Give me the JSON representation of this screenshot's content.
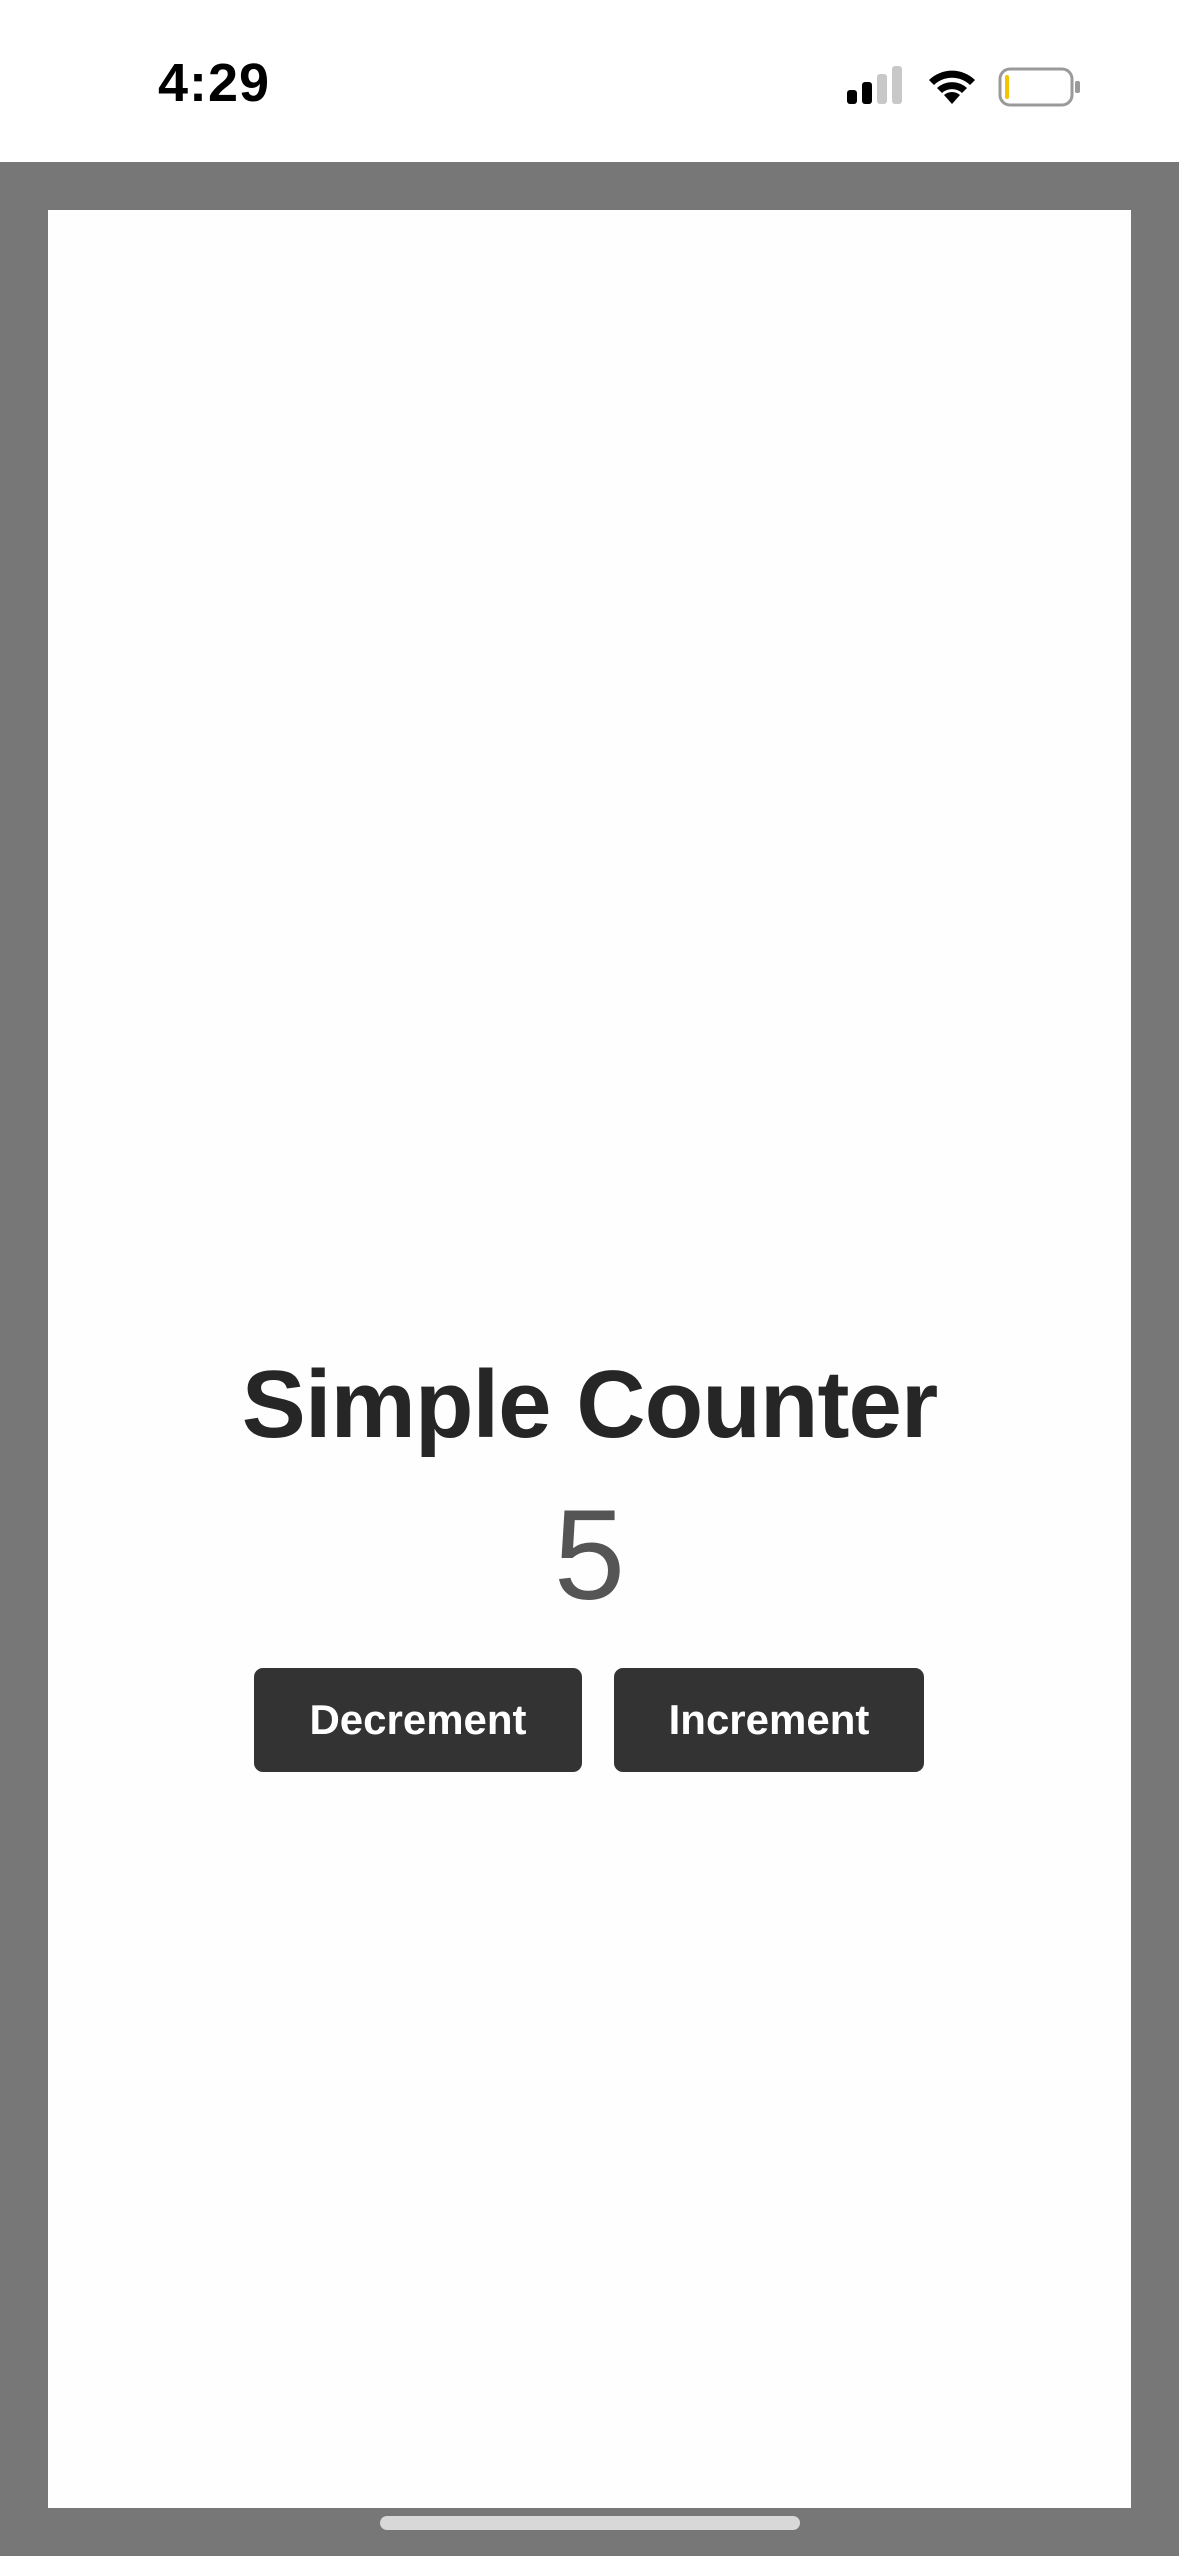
{
  "status_bar": {
    "time": "4:29",
    "signal_icon": "cellular-signal-icon",
    "wifi_icon": "wifi-icon",
    "battery_icon": "battery-low-icon",
    "battery_color": "#f5c400"
  },
  "app": {
    "title": "Simple Counter",
    "count": "5",
    "decrement_label": "Decrement",
    "increment_label": "Increment"
  },
  "colors": {
    "frame": "#777777",
    "background": "#fefefe",
    "button": "#333333",
    "title": "#262626",
    "count": "#555555"
  }
}
